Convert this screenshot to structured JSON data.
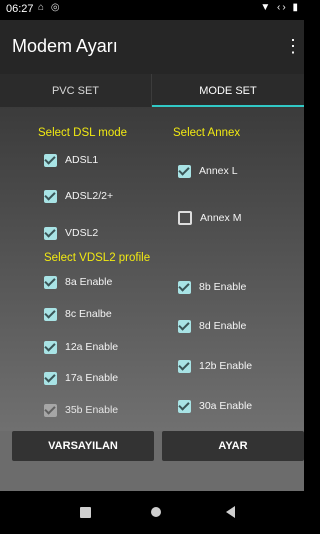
{
  "status_bar": {
    "time": "06:27"
  },
  "app_bar": {
    "title": "Modem Ayarı",
    "menu_glyph": "⋮"
  },
  "tabs": [
    {
      "label": "PVC SET",
      "selected": false
    },
    {
      "label": "MODE SET",
      "selected": true
    }
  ],
  "dsl_mode": {
    "heading": "Select DSL mode",
    "options": [
      {
        "label": "ADSL1",
        "checked": true
      },
      {
        "label": "ADSL2/2+",
        "checked": true
      },
      {
        "label": "VDSL2",
        "checked": true
      }
    ]
  },
  "annex": {
    "heading": "Select Annex",
    "options": [
      {
        "label": "Annex L",
        "checked": true
      },
      {
        "label": "Annex M",
        "checked": false
      }
    ]
  },
  "vdsl2_profile": {
    "heading": "Select VDSL2 profile",
    "left": [
      {
        "label": "8a Enable",
        "checked": true
      },
      {
        "label": "8c Enalbe",
        "checked": true
      },
      {
        "label": "12a Enable",
        "checked": true
      },
      {
        "label": "17a Enable",
        "checked": true
      },
      {
        "label": "35b Enable",
        "checked": true,
        "disabled": true
      }
    ],
    "right": [
      {
        "label": "8b Enable",
        "checked": true
      },
      {
        "label": "8d Enable",
        "checked": true
      },
      {
        "label": "12b Enable",
        "checked": true
      },
      {
        "label": "30a Enable",
        "checked": true
      }
    ]
  },
  "buttons": {
    "default_label": "VARSAYILAN",
    "apply_label": "AYAR"
  },
  "colors": {
    "accent": "#31c9c6",
    "heading": "#f2ea12",
    "checkbox": "#a8e3e5"
  }
}
